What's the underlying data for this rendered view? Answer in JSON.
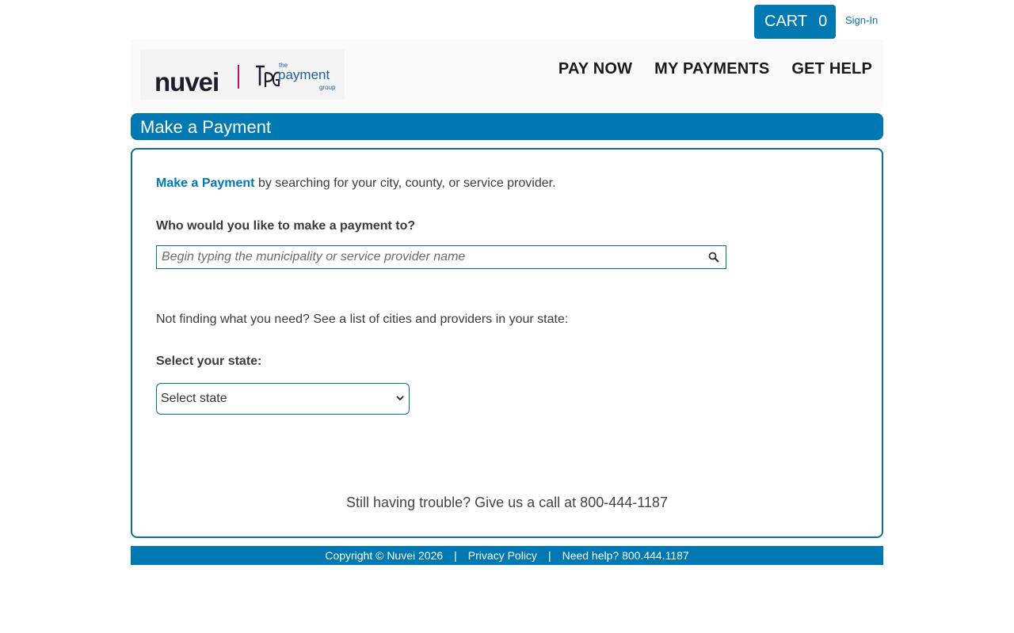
{
  "topbar": {
    "cart_label": "CART",
    "cart_count": "0",
    "signin_label": "Sign-In"
  },
  "logo": {
    "brand": "nuvei",
    "partner_the": "the",
    "partner_payment": "payment",
    "partner_group": "group"
  },
  "nav": {
    "items": [
      {
        "label": "PAY NOW"
      },
      {
        "label": "MY PAYMENTS"
      },
      {
        "label": "GET HELP"
      }
    ]
  },
  "page": {
    "title": "Make a Payment"
  },
  "main": {
    "intro_link": "Make a Payment",
    "intro_rest": " by searching for your city, county, or service provider.",
    "question": "Who would you like to make a payment to?",
    "search_placeholder": "Begin typing the municipality or service provider name",
    "not_finding": "Not finding what you need? See a list of cities and providers in your state:",
    "state_label": "Select your state:",
    "state_selected": "Select state",
    "trouble": "Still having trouble? Give us a call at 800-444-1187"
  },
  "footer": {
    "copyright": "Copyright © Nuvei 2026",
    "sep": "|",
    "privacy": "Privacy Policy",
    "help": "Need help? 800.444.1187"
  },
  "colors": {
    "accent": "#0079b2",
    "border": "#0e6f96",
    "logo_divider": "#c3145b"
  },
  "icons": {
    "search": "search-icon",
    "select": "chevron-down-icon"
  }
}
